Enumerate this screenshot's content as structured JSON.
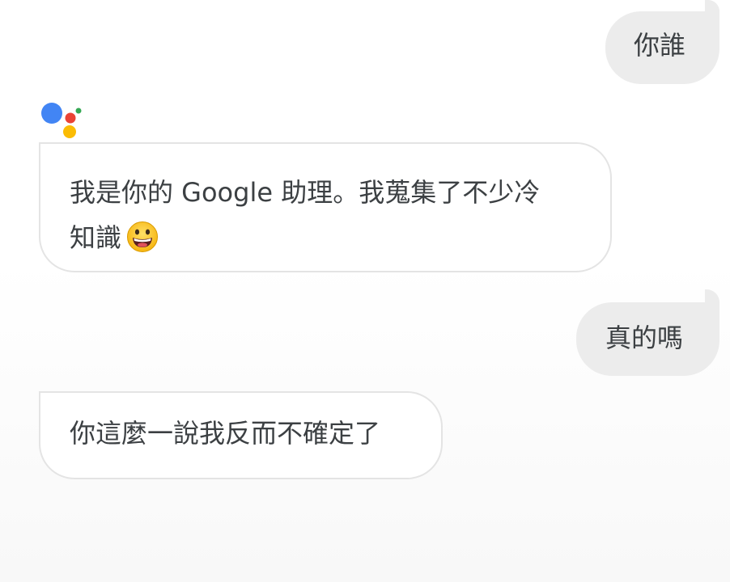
{
  "conversation": {
    "messages": [
      {
        "role": "user",
        "text": "你誰"
      },
      {
        "role": "assistant",
        "line1": "我是你的 Google 助理。我蒐集了不少冷",
        "line2": "知識",
        "emoji": "grinning-face"
      },
      {
        "role": "user",
        "text": "真的嗎"
      },
      {
        "role": "assistant",
        "text": "你這麼一說我反而不確定了"
      }
    ]
  },
  "colors": {
    "user_bubble": "#ececec",
    "assistant_border": "#e4e4e4",
    "text": "#3c4043",
    "logo_blue": "#4285f4",
    "logo_red": "#ea4335",
    "logo_yellow": "#fbbc04",
    "logo_green": "#34a853"
  },
  "icons": {
    "assistant_logo": "google-assistant-logo-icon",
    "emoji": "grinning-face-emoji-icon"
  }
}
